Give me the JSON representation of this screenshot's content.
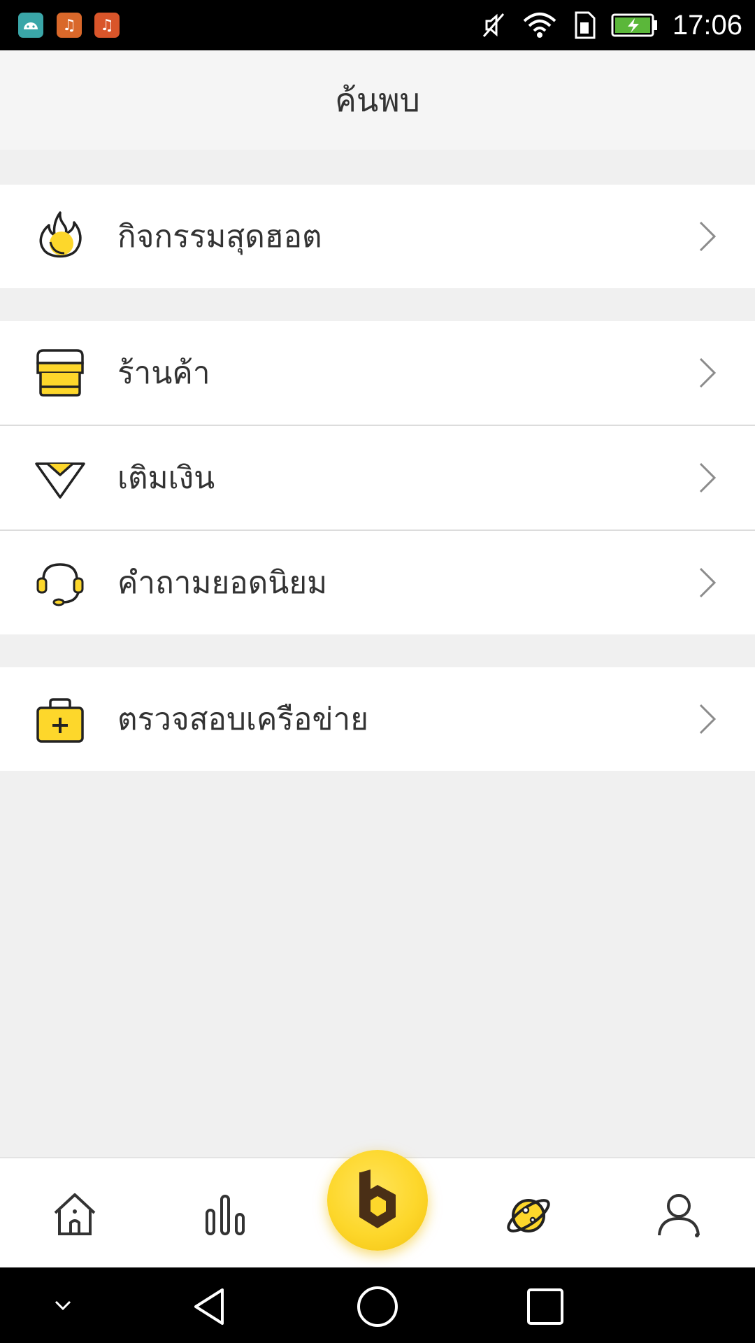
{
  "status_bar": {
    "time": "17:06",
    "notification_icons": [
      "android-app-icon",
      "music-app-icon",
      "music-app-icon"
    ],
    "system_icons": [
      "mute-icon",
      "wifi-icon",
      "sim-icon",
      "battery-charging-icon"
    ]
  },
  "header": {
    "title": "ค้นพบ"
  },
  "menu": {
    "items": [
      {
        "label": "กิจกรรมสุดฮอต",
        "icon": "fire-icon"
      },
      {
        "label": "ร้านค้า",
        "icon": "shop-icon"
      },
      {
        "label": "เติมเงิน",
        "icon": "diamond-icon"
      },
      {
        "label": "คำถามยอดนิยม",
        "icon": "headset-icon"
      },
      {
        "label": "ตรวจสอบเครือข่าย",
        "icon": "first-aid-kit-icon"
      }
    ]
  },
  "bottom_nav": {
    "items": [
      "home-icon",
      "chart-icon",
      "brand-b-icon",
      "planet-icon",
      "profile-icon"
    ],
    "active": "planet-icon"
  },
  "system_nav": [
    "collapse-icon",
    "back-icon",
    "home-circle-icon",
    "recents-icon"
  ],
  "colors": {
    "accent": "#fdd72b",
    "text": "#333333",
    "background": "#f0f0f0"
  }
}
